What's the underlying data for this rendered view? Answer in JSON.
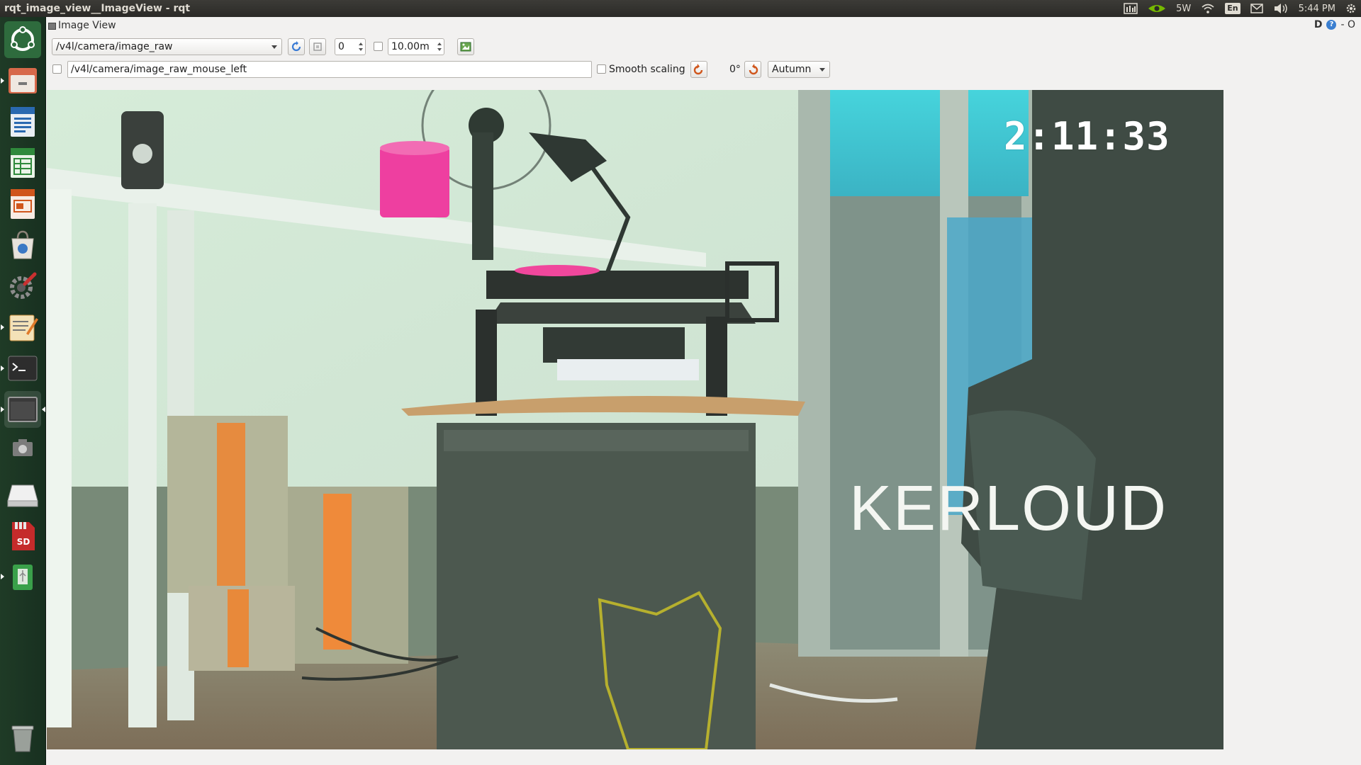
{
  "window_title": "rqt_image_view__ImageView - rqt",
  "panel": {
    "power_label": "5W",
    "lang": "En",
    "clock": "5:44 PM"
  },
  "launcher": {
    "items": [
      {
        "name": "dash-home-icon"
      },
      {
        "name": "files-icon"
      },
      {
        "name": "writer-icon"
      },
      {
        "name": "calc-icon"
      },
      {
        "name": "impress-icon"
      },
      {
        "name": "software-center-icon"
      },
      {
        "name": "system-settings-icon"
      },
      {
        "name": "text-editor-icon"
      },
      {
        "name": "terminal-icon"
      },
      {
        "name": "window-icon"
      },
      {
        "name": "screenshot-icon"
      },
      {
        "name": "drive-icon"
      },
      {
        "name": "sd-card-icon"
      },
      {
        "name": "usb-icon"
      },
      {
        "name": "trash-icon"
      }
    ]
  },
  "plugin": {
    "title": "Image View",
    "help_label": "D",
    "help_q": "?",
    "extra": "- O"
  },
  "toolbar": {
    "topic": "/v4l/camera/image_raw",
    "spin_value": "0",
    "spin_value2": "10.00m",
    "mouse_topic": "/v4l/camera/image_raw_mouse_left",
    "smooth_label": "Smooth scaling",
    "rotation": "0°",
    "colormap": "Autumn"
  },
  "image": {
    "timestamp": "2:11:33",
    "brand": "KERLOUD"
  },
  "colors": {
    "panel_bg": "#2b2a27",
    "launcher_bg": "#1f3b26",
    "window_bg": "#f2f1f0",
    "accent_orange": "#e0621c"
  }
}
